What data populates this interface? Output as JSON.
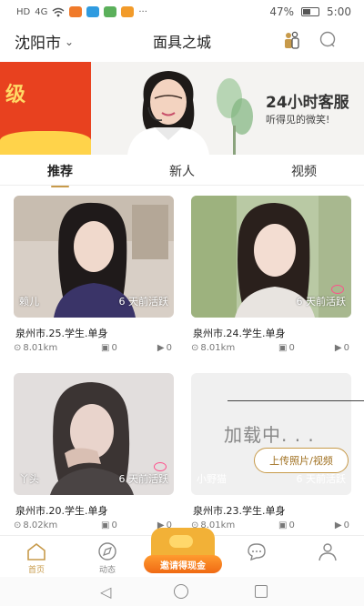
{
  "status_bar": {
    "left_indicators": [
      "HD",
      "4G"
    ],
    "battery": "47%",
    "time": "5:00"
  },
  "header": {
    "city": "沈阳市",
    "title": "面具之城"
  },
  "banner": {
    "left_text": "级",
    "headline": "24小时客服",
    "subline": "听得见的微笑!"
  },
  "tabs": [
    {
      "label": "推荐",
      "active": true
    },
    {
      "label": "新人",
      "active": false
    },
    {
      "label": "视频",
      "active": false
    }
  ],
  "cards": [
    {
      "nickname": "赖儿",
      "activity": "6 天前活跃",
      "info": "泉州市.25.学生.单身",
      "distance": "8.01km",
      "photos": "0",
      "videos": "0"
    },
    {
      "nickname": "",
      "activity": "6 天前活跃",
      "info": "泉州市.24.学生.单身",
      "distance": "8.01km",
      "photos": "0",
      "videos": "0"
    },
    {
      "nickname": "丫头",
      "activity": "6 天前活跃",
      "info": "泉州市.20.学生.单身",
      "distance": "8.02km",
      "photos": "0",
      "videos": "0"
    },
    {
      "nickname": "小野猫",
      "activity": "6 天前活跃",
      "info": "泉州市.23.学生.单身",
      "distance": "8.01km",
      "photos": "0",
      "videos": "0"
    }
  ],
  "loading_text": "加载中. . .",
  "upload_label": "上传照片/视频",
  "bottom_nav": {
    "home": "首页",
    "moments": "动态",
    "invite": "邀请得现金",
    "messages": "",
    "profile": ""
  },
  "colors": {
    "accent": "#c79a4a",
    "banner_red": "#e8411f",
    "invite_orange": "#f06a14"
  }
}
